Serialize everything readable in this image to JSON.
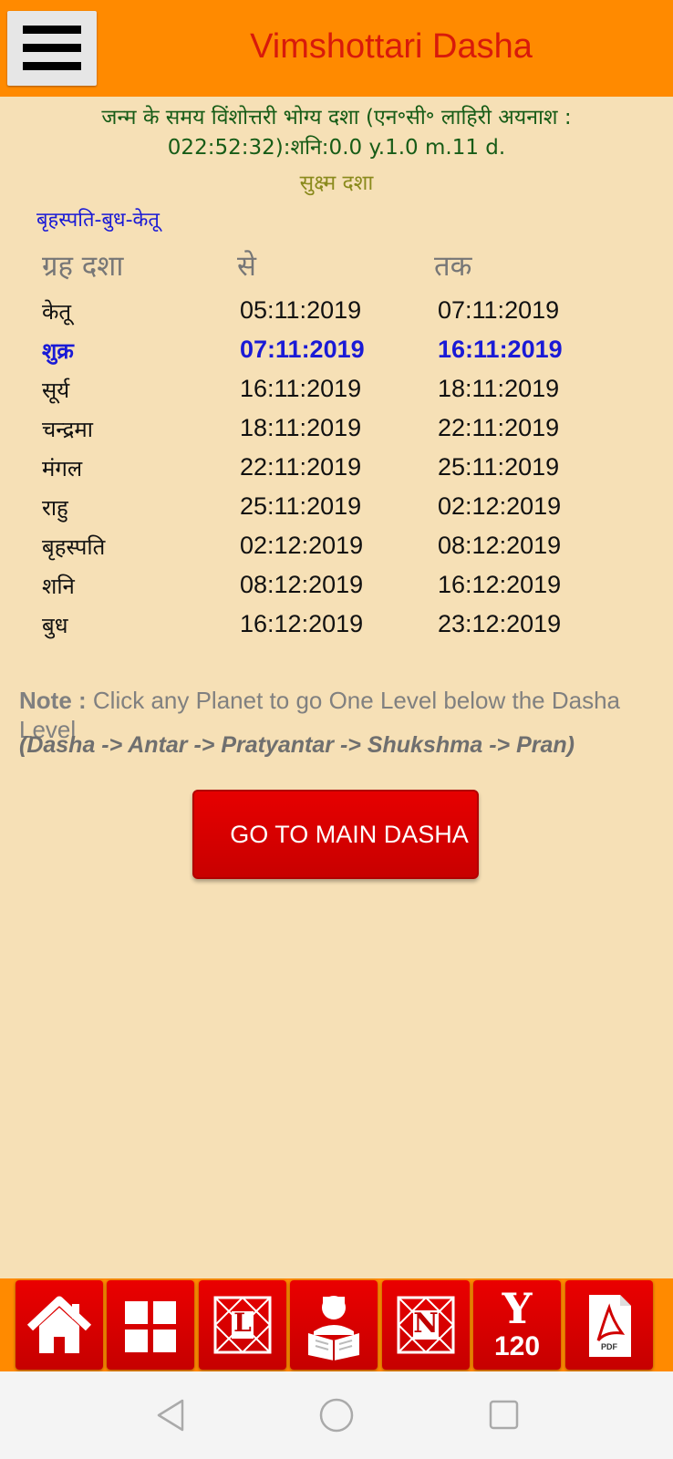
{
  "app_bar": {
    "title": "Vimshottari Dasha",
    "menu_icon": "hamburger-menu-icon"
  },
  "birth_info": "जन्म के समय विंशोत्तरी भोग्य दशा (एन॰सी॰ लाहिरी अयनाश : 022:52:32):शनि:0.0 y.1.0 m.11 d.",
  "section_label": "सुक्ष्म दशा",
  "path_label": "बृहस्पति-बुध-केतू",
  "table": {
    "headers": [
      "ग्रह दशा",
      "से",
      "तक"
    ],
    "rows": [
      {
        "planet": "केतू",
        "from": "05:11:2019",
        "to": "07:11:2019",
        "active": false
      },
      {
        "planet": "शुक्र",
        "from": "07:11:2019",
        "to": "16:11:2019",
        "active": true
      },
      {
        "planet": "सूर्य",
        "from": "16:11:2019",
        "to": "18:11:2019",
        "active": false
      },
      {
        "planet": "चन्द्रमा",
        "from": "18:11:2019",
        "to": "22:11:2019",
        "active": false
      },
      {
        "planet": "मंगल",
        "from": "22:11:2019",
        "to": "25:11:2019",
        "active": false
      },
      {
        "planet": "राहु",
        "from": "25:11:2019",
        "to": "02:12:2019",
        "active": false
      },
      {
        "planet": "बृहस्पति",
        "from": "02:12:2019",
        "to": "08:12:2019",
        "active": false
      },
      {
        "planet": "शनि",
        "from": "08:12:2019",
        "to": "16:12:2019",
        "active": false
      },
      {
        "planet": "बुध",
        "from": "16:12:2019",
        "to": "23:12:2019",
        "active": false
      }
    ]
  },
  "note": {
    "key": "Note :",
    "text": " Click any Planet to go One Level below the Dasha Level",
    "levels": "(Dasha -> Antar -> Pratyantar -> Shukshma -> Pran)"
  },
  "main_dasha_button": "GO TO MAIN DASHA",
  "toolbar": {
    "items": [
      {
        "icon": "home-icon"
      },
      {
        "icon": "grid-icon"
      },
      {
        "icon": "lagna-chart-icon",
        "glyph": "L"
      },
      {
        "icon": "reader-icon"
      },
      {
        "icon": "navamsa-chart-icon",
        "glyph": "N"
      },
      {
        "icon": "yearly-120-icon",
        "glyph": "Y",
        "number": "120"
      },
      {
        "icon": "pdf-icon",
        "label": "PDF"
      }
    ]
  },
  "colors": {
    "app_bar": "#ff8a00",
    "title": "#d81a0b",
    "background": "#f6e0b6",
    "active_row": "#1a1ad6",
    "birth_info": "#175c17",
    "button_red": "#d40000"
  }
}
